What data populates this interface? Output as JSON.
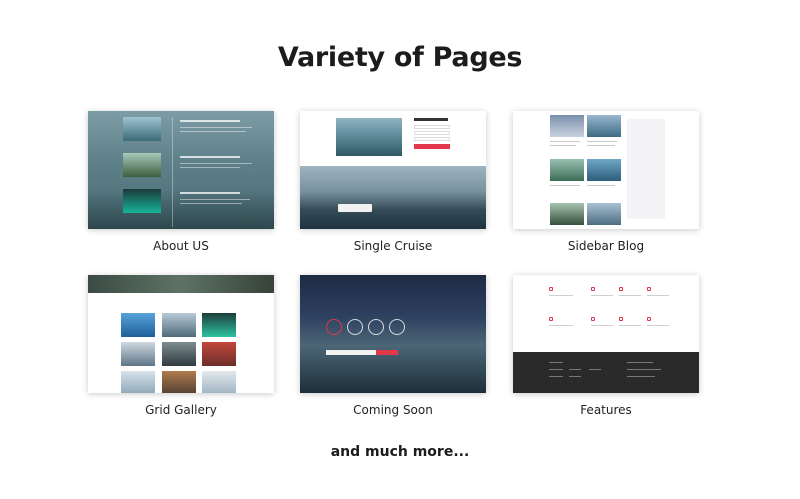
{
  "title": "Variety of Pages",
  "cards": [
    {
      "caption": "About US"
    },
    {
      "caption": "Single Cruise"
    },
    {
      "caption": "Sidebar Blog"
    },
    {
      "caption": "Grid Gallery"
    },
    {
      "caption": "Coming Soon"
    },
    {
      "caption": "Features"
    }
  ],
  "more_text": "and much more...",
  "colors": {
    "accent": "#e5374a",
    "text": "#1c1c1c",
    "background": "#ffffff"
  }
}
